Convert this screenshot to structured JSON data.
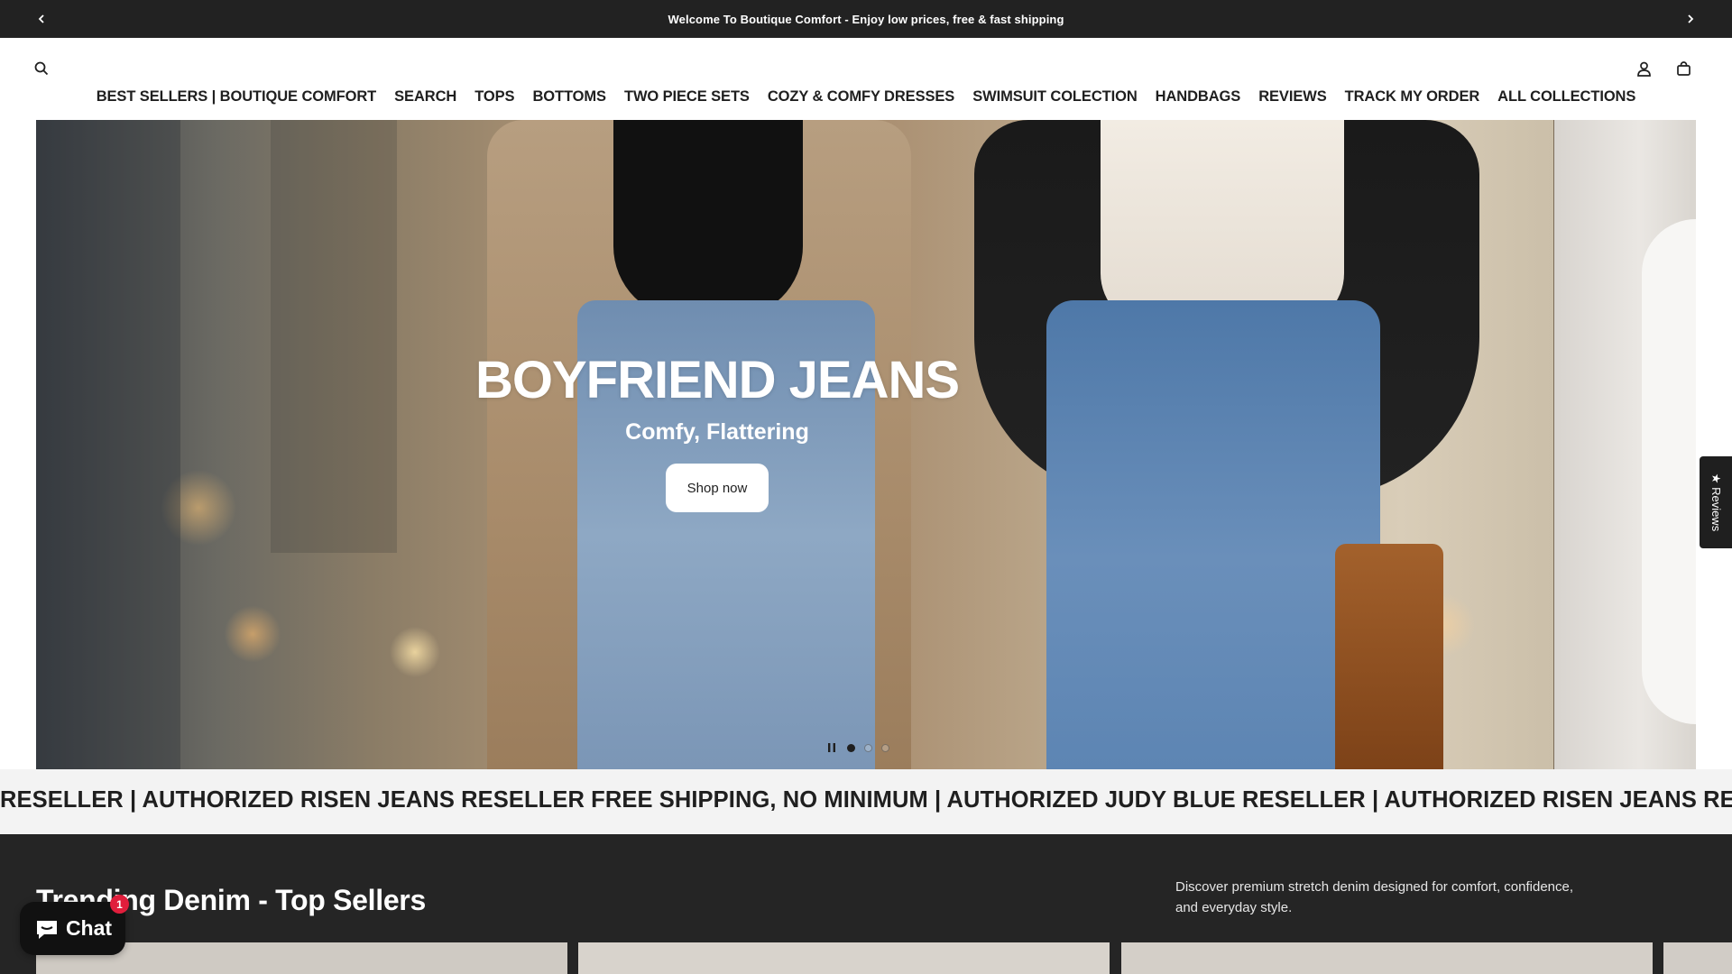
{
  "announcement": {
    "text": "Welcome To Boutique Comfort - Enjoy low prices, free & fast shipping"
  },
  "icons": {
    "prev": "chevron-left-icon",
    "next": "chevron-right-icon",
    "search": "search-icon",
    "account": "account-icon",
    "cart": "cart-icon",
    "pause": "pause-icon",
    "chat": "chat-bubble-icon"
  },
  "nav": {
    "items": [
      "BEST SELLERS | BOUTIQUE COMFORT",
      "SEARCH",
      "TOPS",
      "BOTTOMS",
      "TWO PIECE SETS",
      "COZY & COMFY DRESSES",
      "SWIMSUIT COLECTION",
      "HANDBAGS",
      "REVIEWS",
      "TRACK MY ORDER",
      "ALL COLLECTIONS"
    ]
  },
  "hero": {
    "title": "BOYFRIEND JEANS",
    "subtitle": "Comfy, Flattering",
    "button_label": "Shop now",
    "slide_count": 3,
    "active_slide": 1
  },
  "reviews_tab": {
    "label": "★ Reviews"
  },
  "marquee": {
    "text": "RESELLER | AUTHORIZED RISEN JEANS RESELLER   FREE SHIPPING, NO MINIMUM | AUTHORIZED JUDY BLUE RESELLER | AUTHORIZED RISEN JEANS RESELLER"
  },
  "trending": {
    "title": "Trending Denim - Top Sellers",
    "description": "Discover premium stretch denim designed for comfort, confidence, and everyday style."
  },
  "chat": {
    "label": "Chat",
    "badge": "1"
  },
  "colors": {
    "announcement_bg": "#222222",
    "dark_section_bg": "#252525",
    "marquee_bg": "#f3f3f3",
    "chat_badge": "#e01e3c"
  }
}
